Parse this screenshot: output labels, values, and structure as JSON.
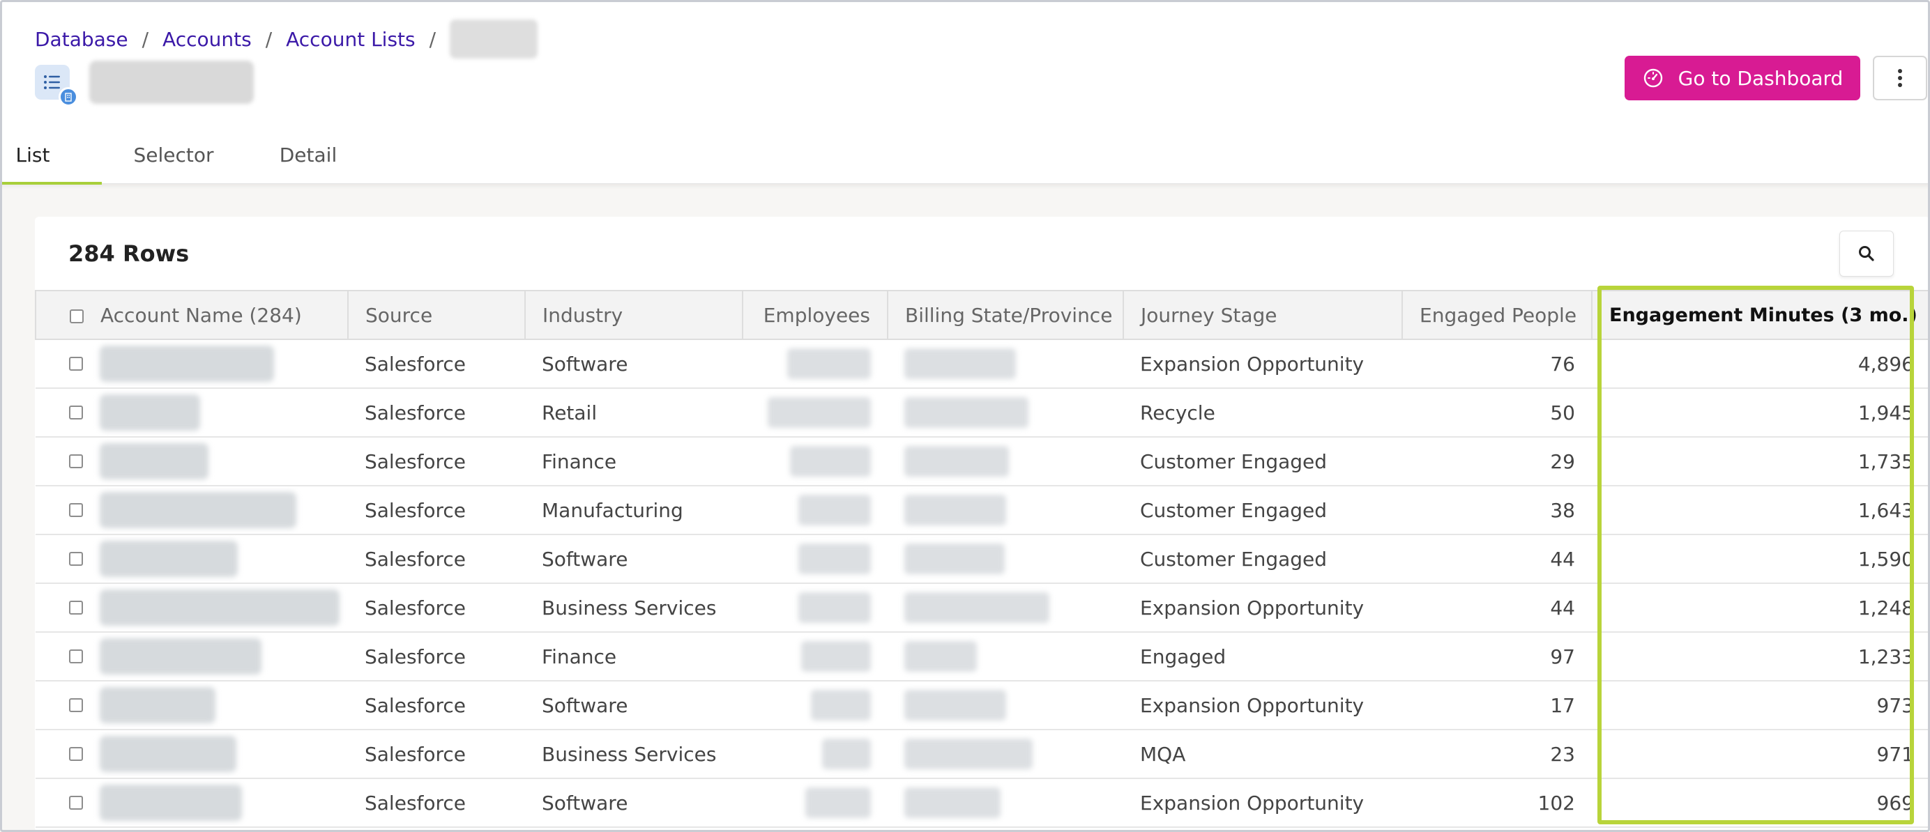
{
  "breadcrumb": {
    "items": [
      "Database",
      "Accounts",
      "Account Lists"
    ],
    "separator": "/"
  },
  "actions": {
    "dashboard_label": "Go to Dashboard"
  },
  "tabs": [
    "List",
    "Selector",
    "Detail"
  ],
  "table": {
    "row_count": "284 Rows",
    "columns": [
      "Account Name (284)",
      "Source",
      "Industry",
      "Employees",
      "Billing State/Province",
      "Journey Stage",
      "Engaged People",
      "Engagement Minutes (3 mo.)"
    ],
    "rows": [
      {
        "source": "Salesforce",
        "industry": "Software",
        "stage": "Expansion Opportunity",
        "engaged": "76",
        "minutes": "4,896"
      },
      {
        "source": "Salesforce",
        "industry": "Retail",
        "stage": "Recycle",
        "engaged": "50",
        "minutes": "1,945"
      },
      {
        "source": "Salesforce",
        "industry": "Finance",
        "stage": "Customer Engaged",
        "engaged": "29",
        "minutes": "1,735"
      },
      {
        "source": "Salesforce",
        "industry": "Manufacturing",
        "stage": "Customer Engaged",
        "engaged": "38",
        "minutes": "1,643"
      },
      {
        "source": "Salesforce",
        "industry": "Software",
        "stage": "Customer Engaged",
        "engaged": "44",
        "minutes": "1,590"
      },
      {
        "source": "Salesforce",
        "industry": "Business Services",
        "stage": "Expansion Opportunity",
        "engaged": "44",
        "minutes": "1,248"
      },
      {
        "source": "Salesforce",
        "industry": "Finance",
        "stage": "Engaged",
        "engaged": "97",
        "minutes": "1,233"
      },
      {
        "source": "Salesforce",
        "industry": "Software",
        "stage": "Expansion Opportunity",
        "engaged": "17",
        "minutes": "973"
      },
      {
        "source": "Salesforce",
        "industry": "Business Services",
        "stage": "MQA",
        "engaged": "23",
        "minutes": "971"
      },
      {
        "source": "Salesforce",
        "industry": "Software",
        "stage": "Expansion Opportunity",
        "engaged": "102",
        "minutes": "969"
      }
    ]
  },
  "colors": {
    "accent_magenta": "#d81b93",
    "highlight_green": "#b8d43a",
    "link_purple": "#3b19a8",
    "tab_underline": "#a8cf3a"
  },
  "icons": [
    "list-icon",
    "building-icon",
    "dashboard-gauge-icon",
    "more-vertical-icon",
    "search-icon"
  ]
}
